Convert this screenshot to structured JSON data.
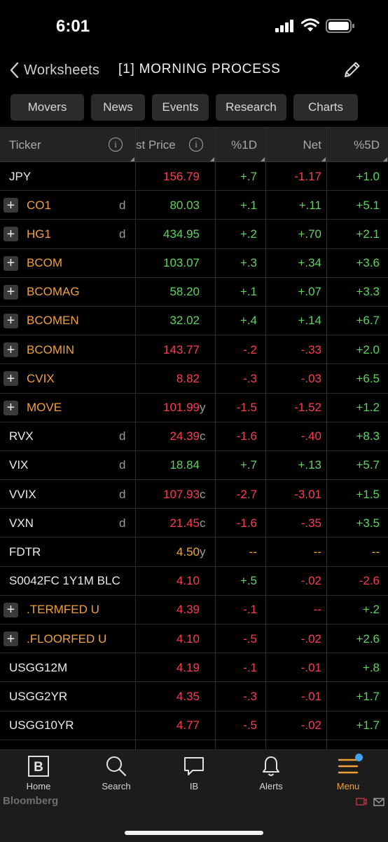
{
  "status_bar": {
    "time": "6:01"
  },
  "nav": {
    "back_label": "Worksheets",
    "title": "[1] MORNING PROCESS"
  },
  "chips": [
    "Movers",
    "News",
    "Events",
    "Research",
    "Charts"
  ],
  "columns": {
    "ticker": "Ticker",
    "last_price": "st Price",
    "pct1d": "%1D",
    "net": "Net",
    "pct5d": "%5D"
  },
  "colors": {
    "green": "#5fd35f",
    "red": "#ff3b4f",
    "orange": "#f1a03a",
    "white": "#e9e9e9",
    "amber": "#f0a93a",
    "accent": "#f1a03a"
  },
  "rows": [
    {
      "ticker": "JPY",
      "tcolor": "white",
      "plus": false,
      "flag": "",
      "price": "156.79",
      "pcolor": "red",
      "suffix": "",
      "d1": "+.7",
      "d1c": "green",
      "net": "-1.17",
      "netc": "red",
      "d5": "+1.0",
      "d5c": "green"
    },
    {
      "ticker": "CO1",
      "tcolor": "orange",
      "plus": true,
      "flag": "d",
      "price": "80.03",
      "pcolor": "green",
      "suffix": "",
      "d1": "+.1",
      "d1c": "green",
      "net": "+.11",
      "netc": "green",
      "d5": "+5.1",
      "d5c": "green"
    },
    {
      "ticker": "HG1",
      "tcolor": "orange",
      "plus": true,
      "flag": "d",
      "price": "434.95",
      "pcolor": "green",
      "suffix": "",
      "d1": "+.2",
      "d1c": "green",
      "net": "+.70",
      "netc": "green",
      "d5": "+2.1",
      "d5c": "green"
    },
    {
      "ticker": "BCOM",
      "tcolor": "orange",
      "plus": true,
      "flag": "",
      "price": "103.07",
      "pcolor": "green",
      "suffix": "",
      "d1": "+.3",
      "d1c": "green",
      "net": "+.34",
      "netc": "green",
      "d5": "+3.6",
      "d5c": "green"
    },
    {
      "ticker": "BCOMAG",
      "tcolor": "orange",
      "plus": true,
      "flag": "",
      "price": "58.20",
      "pcolor": "green",
      "suffix": "",
      "d1": "+.1",
      "d1c": "green",
      "net": "+.07",
      "netc": "green",
      "d5": "+3.3",
      "d5c": "green"
    },
    {
      "ticker": "BCOMEN",
      "tcolor": "orange",
      "plus": true,
      "flag": "",
      "price": "32.02",
      "pcolor": "green",
      "suffix": "",
      "d1": "+.4",
      "d1c": "green",
      "net": "+.14",
      "netc": "green",
      "d5": "+6.7",
      "d5c": "green"
    },
    {
      "ticker": "BCOMIN",
      "tcolor": "orange",
      "plus": true,
      "flag": "",
      "price": "143.77",
      "pcolor": "red",
      "suffix": "",
      "d1": "-.2",
      "d1c": "red",
      "net": "-.33",
      "netc": "red",
      "d5": "+2.0",
      "d5c": "green"
    },
    {
      "ticker": "CVIX",
      "tcolor": "orange",
      "plus": true,
      "flag": "",
      "price": "8.82",
      "pcolor": "red",
      "suffix": "",
      "d1": "-.3",
      "d1c": "red",
      "net": "-.03",
      "netc": "red",
      "d5": "+6.5",
      "d5c": "green"
    },
    {
      "ticker": "MOVE",
      "tcolor": "orange",
      "plus": true,
      "flag": "",
      "price": "101.99",
      "pcolor": "red",
      "suffix": "y",
      "d1": "-1.5",
      "d1c": "red",
      "net": "-1.52",
      "netc": "red",
      "d5": "+1.2",
      "d5c": "green"
    },
    {
      "ticker": "RVX",
      "tcolor": "white",
      "plus": false,
      "flag": "d",
      "price": "24.39",
      "pcolor": "red",
      "suffix": "c",
      "d1": "-1.6",
      "d1c": "red",
      "net": "-.40",
      "netc": "red",
      "d5": "+8.3",
      "d5c": "green"
    },
    {
      "ticker": "VIX",
      "tcolor": "white",
      "plus": false,
      "flag": "d",
      "price": "18.84",
      "pcolor": "green",
      "suffix": "",
      "d1": "+.7",
      "d1c": "green",
      "net": "+.13",
      "netc": "green",
      "d5": "+5.7",
      "d5c": "green"
    },
    {
      "ticker": "VVIX",
      "tcolor": "white",
      "plus": false,
      "flag": "d",
      "price": "107.93",
      "pcolor": "red",
      "suffix": "c",
      "d1": "-2.7",
      "d1c": "red",
      "net": "-3.01",
      "netc": "red",
      "d5": "+1.5",
      "d5c": "green"
    },
    {
      "ticker": "VXN",
      "tcolor": "white",
      "plus": false,
      "flag": "d",
      "price": "21.45",
      "pcolor": "red",
      "suffix": "c",
      "d1": "-1.6",
      "d1c": "red",
      "net": "-.35",
      "netc": "red",
      "d5": "+3.5",
      "d5c": "green"
    },
    {
      "ticker": "FDTR",
      "tcolor": "white",
      "plus": false,
      "flag": "",
      "price": "4.50",
      "pcolor": "amber",
      "suffix": "y",
      "d1": "--",
      "d1c": "amber",
      "net": "--",
      "netc": "amber",
      "d5": "--",
      "d5c": "amber"
    },
    {
      "ticker": "S0042FC 1Y1M BLC",
      "tcolor": "white",
      "plus": false,
      "flag": "",
      "price": "4.10",
      "pcolor": "red",
      "suffix": "",
      "d1": "+.5",
      "d1c": "green",
      "net": "-.02",
      "netc": "red",
      "d5": "-2.6",
      "d5c": "red"
    },
    {
      "ticker": ".TERMFED U",
      "tcolor": "orange",
      "plus": true,
      "flag": "",
      "price": "4.39",
      "pcolor": "red",
      "suffix": "",
      "d1": "-.1",
      "d1c": "red",
      "net": "--",
      "netc": "red",
      "d5": "+.2",
      "d5c": "green"
    },
    {
      "ticker": ".FLOORFED U",
      "tcolor": "orange",
      "plus": true,
      "flag": "",
      "price": "4.10",
      "pcolor": "red",
      "suffix": "",
      "d1": "-.5",
      "d1c": "red",
      "net": "-.02",
      "netc": "red",
      "d5": "+2.6",
      "d5c": "green"
    },
    {
      "ticker": "USGG12M",
      "tcolor": "white",
      "plus": false,
      "flag": "",
      "price": "4.19",
      "pcolor": "red",
      "suffix": "",
      "d1": "-.1",
      "d1c": "red",
      "net": "-.01",
      "netc": "red",
      "d5": "+.8",
      "d5c": "green"
    },
    {
      "ticker": "USGG2YR",
      "tcolor": "white",
      "plus": false,
      "flag": "",
      "price": "4.35",
      "pcolor": "red",
      "suffix": "",
      "d1": "-.3",
      "d1c": "red",
      "net": "-.01",
      "netc": "red",
      "d5": "+1.7",
      "d5c": "green"
    },
    {
      "ticker": "USGG10YR",
      "tcolor": "white",
      "plus": false,
      "flag": "",
      "price": "4.77",
      "pcolor": "red",
      "suffix": "",
      "d1": "-.5",
      "d1c": "red",
      "net": "-.02",
      "netc": "red",
      "d5": "+1.7",
      "d5c": "green"
    }
  ],
  "tabs": [
    {
      "label": "Home",
      "icon": "bloomberg-b-icon",
      "active": false
    },
    {
      "label": "Search",
      "icon": "search-icon",
      "active": false
    },
    {
      "label": "IB",
      "icon": "chat-bubble-icon",
      "active": false
    },
    {
      "label": "Alerts",
      "icon": "bell-icon",
      "active": false
    },
    {
      "label": "Menu",
      "icon": "menu-icon",
      "active": true
    }
  ],
  "brand": "Bloomberg"
}
